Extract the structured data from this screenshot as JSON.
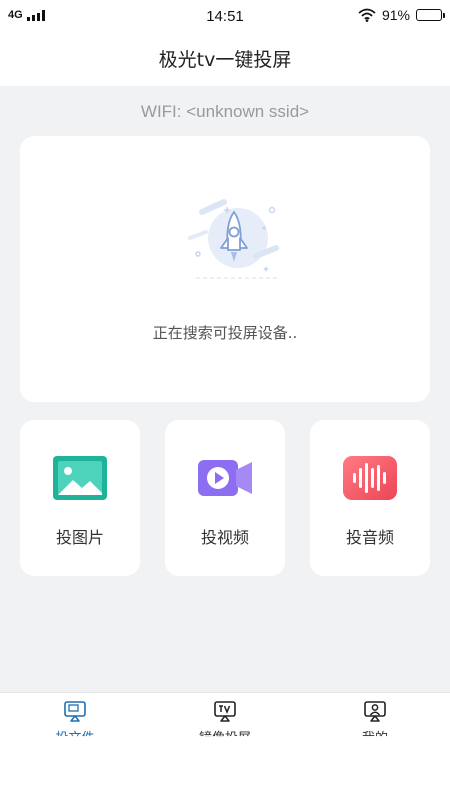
{
  "status_bar": {
    "network": "4G",
    "time": "14:51",
    "battery_percent": "91%",
    "battery_level": 0.91
  },
  "nav": {
    "title": "极光tv一键投屏"
  },
  "wifi": {
    "label": "WIFI: <unknown ssid>"
  },
  "search": {
    "status_text": "正在搜索可投屏设备.."
  },
  "actions": [
    {
      "label": "投图片",
      "icon": "image-icon",
      "color": "#25b8a0"
    },
    {
      "label": "投视频",
      "icon": "video-camera-icon",
      "color": "#8a6cf0"
    },
    {
      "label": "投音频",
      "icon": "audio-wave-icon",
      "color": "#f05a68"
    }
  ],
  "tabs": [
    {
      "label": "投文件",
      "icon": "file-cast-icon",
      "active": true
    },
    {
      "label": "镜像投屏",
      "icon": "tv-mirror-icon",
      "active": false
    },
    {
      "label": "我的",
      "icon": "user-profile-icon",
      "active": false
    }
  ],
  "colors": {
    "accent": "#1e6fb3",
    "background": "#f1f2f4"
  }
}
